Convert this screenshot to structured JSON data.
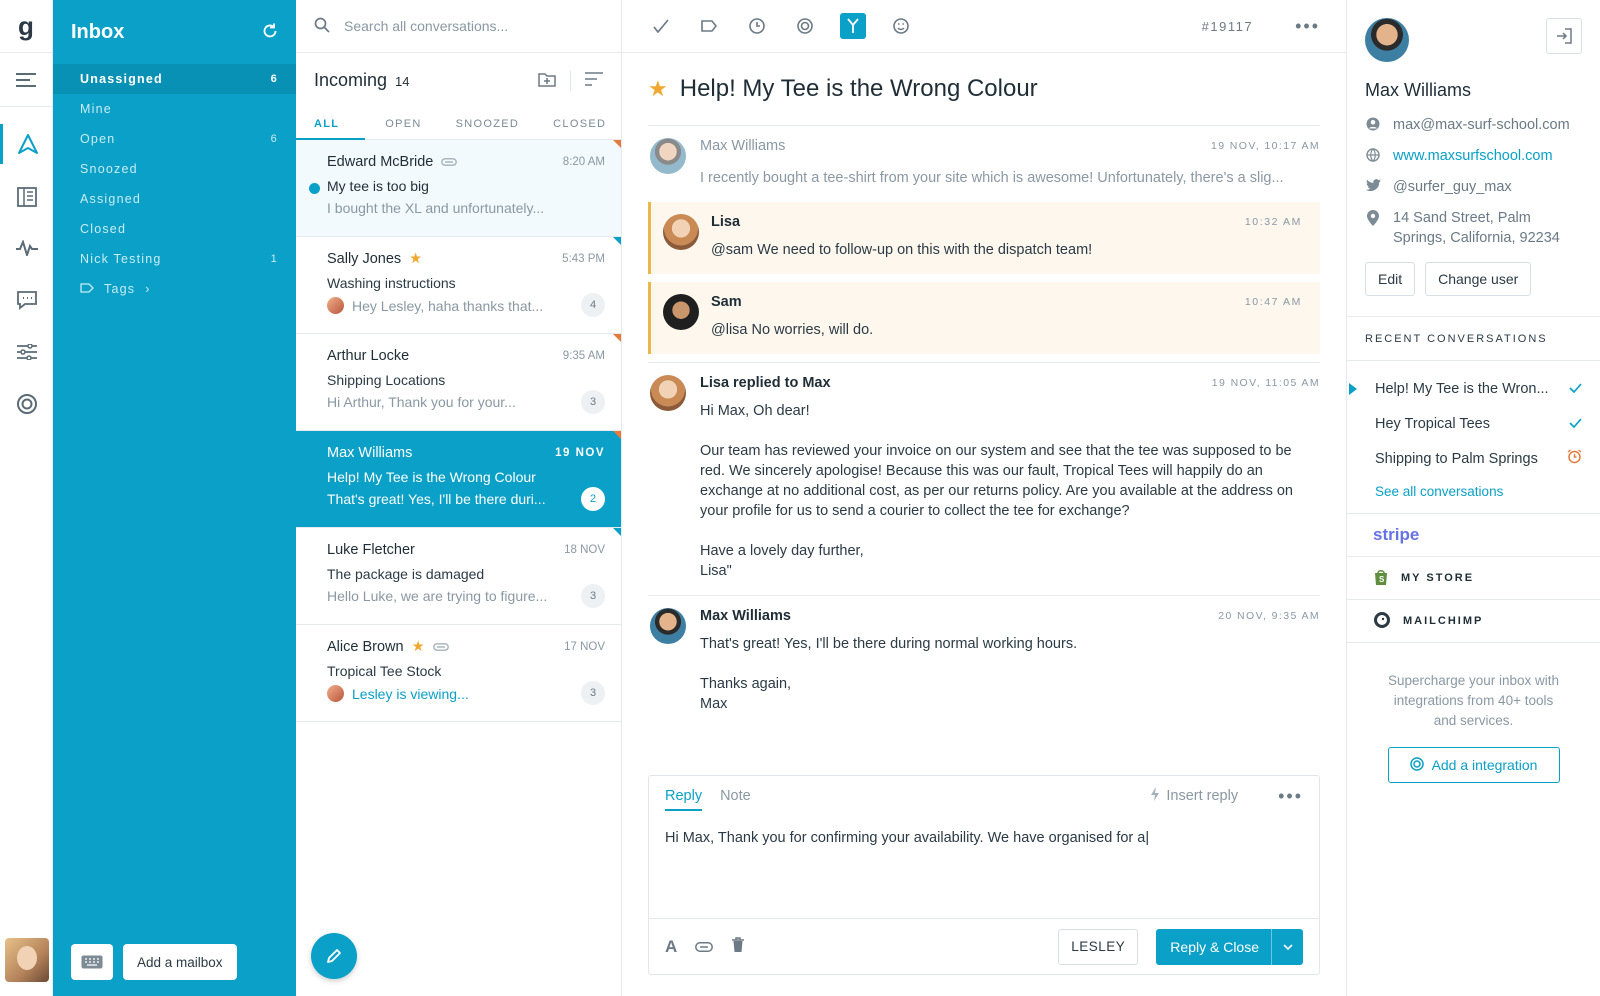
{
  "rail": {
    "logo": "g",
    "icons": [
      "menu-icon",
      "send-icon",
      "book-icon",
      "activity-icon",
      "chat-icon",
      "sliders-icon",
      "help-icon"
    ]
  },
  "sidebar": {
    "title": "Inbox",
    "folders": [
      {
        "label": "Unassigned",
        "count": "6"
      },
      {
        "label": "Mine",
        "count": ""
      },
      {
        "label": "Open",
        "count": "6"
      },
      {
        "label": "Snoozed",
        "count": ""
      },
      {
        "label": "Assigned",
        "count": ""
      },
      {
        "label": "Closed",
        "count": ""
      },
      {
        "label": "Nick Testing",
        "count": "1"
      }
    ],
    "tags_label": "Tags",
    "add_mailbox": "Add a mailbox"
  },
  "list": {
    "search_placeholder": "Search all conversations...",
    "heading": "Incoming",
    "heading_count": "14",
    "tabs": [
      "ALL",
      "OPEN",
      "SNOOZED",
      "CLOSED"
    ],
    "conversations": [
      {
        "name": "Edward McBride",
        "time": "8:20 AM",
        "subject": "My tee is too big",
        "preview": "I bought the XL and unfortunately...",
        "count": ""
      },
      {
        "name": "Sally Jones",
        "time": "5:43 PM",
        "subject": "Washing instructions",
        "preview": "Hey Lesley, haha thanks that...",
        "count": "4"
      },
      {
        "name": "Arthur Locke",
        "time": "9:35 AM",
        "subject": "Shipping Locations",
        "preview": "Hi Arthur, Thank you for your...",
        "count": "3"
      },
      {
        "name": "Max Williams",
        "time": "19 NOV",
        "subject": "Help! My Tee is the Wrong Colour",
        "preview": "That's great! Yes, I'll be there duri...",
        "count": "2"
      },
      {
        "name": "Luke Fletcher",
        "time": "18 NOV",
        "subject": "The package is damaged",
        "preview": "Hello Luke, we are trying to figure...",
        "count": "3"
      },
      {
        "name": "Alice Brown",
        "time": "17 NOV",
        "subject": "Tropical Tee Stock",
        "preview": "Lesley is viewing...",
        "count": "3"
      }
    ]
  },
  "main": {
    "ticket": "#19117",
    "subject": "Help! My Tee is the Wrong Colour",
    "messages": [
      {
        "who": "Max Williams",
        "when": "19 NOV, 10:17 AM",
        "body": "I recently bought a tee-shirt from your site which is awesome! Unfortunately, there's a slig..."
      },
      {
        "who": "Lisa",
        "when": "10:32 AM",
        "body": "@sam We need to follow-up on this with the dispatch team!"
      },
      {
        "who": "Sam",
        "when": "10:47 AM",
        "body": "@lisa No worries, will do."
      },
      {
        "who": "Lisa replied to Max",
        "when": "19 NOV, 11:05 AM",
        "p1": "Hi Max, Oh dear!",
        "p2": "Our team has reviewed your invoice on our system and see that the tee was supposed to be red. We sincerely apologise! Because this was our fault, Tropical Tees will happily do an exchange at no additional cost, as per our returns policy. Are you available at the address on your profile for us to send a courier to collect the tee for exchange?",
        "p3a": "Have a lovely day further,",
        "p3b": "Lisa\""
      },
      {
        "who": "Max Williams",
        "when": "20 NOV, 9:35 AM",
        "p1": "That's great! Yes, I'll be there during normal working hours.",
        "p2a": "Thanks again,",
        "p2b": "Max"
      }
    ],
    "composer": {
      "reply_tab": "Reply",
      "note_tab": "Note",
      "insert_reply": "Insert reply",
      "draft": "Hi Max, Thank you for confirming your availability. We have organised for a|",
      "assignee": "LESLEY",
      "send": "Reply & Close"
    }
  },
  "profile": {
    "name": "Max Williams",
    "email": "max@max-surf-school.com",
    "website": "www.maxsurfschool.com",
    "twitter": "@surfer_guy_max",
    "address_line1": "14 Sand Street, Palm",
    "address_line2": "Springs, California, 92234",
    "edit": "Edit",
    "change_user": "Change user",
    "recent_heading": "RECENT CONVERSATIONS",
    "recent": [
      {
        "label": "Help! My Tee is the Wron...",
        "status": "check-icon"
      },
      {
        "label": "Hey Tropical Tees",
        "status": "check-icon"
      },
      {
        "label": "Shipping to Palm Springs",
        "status": "alarm-icon"
      }
    ],
    "see_all": "See all conversations",
    "integrations": [
      "stripe",
      "MY STORE",
      "MAILCHIMP"
    ],
    "promo_line1": "Supercharge your inbox with",
    "promo_line2": "integrations from 40+ tools",
    "promo_line3": "and services.",
    "add_integration": "Add a integration"
  },
  "colors": {
    "accent": "#0aa0c7",
    "note_bg": "#fdf7ee",
    "note_border": "#e8b84b",
    "star": "#f0a830",
    "alert": "#e57a3c"
  }
}
